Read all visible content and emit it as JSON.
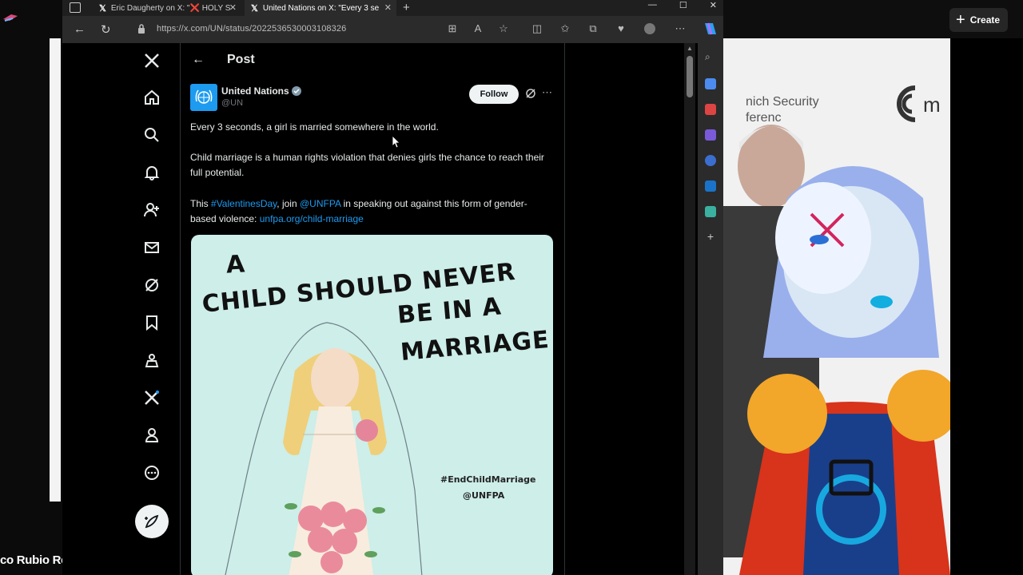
{
  "background": {
    "bottom_name": "co Rubio Re",
    "create_button": "Create",
    "stream_panel_text": "nich Security\nferenc"
  },
  "browser": {
    "tabs": [
      {
        "title": "Eric Daugherty on X: \"❌ HOLY S"
      },
      {
        "title": "United Nations on X: \"Every 3 se"
      }
    ],
    "url": "https://x.com/UN/status/2022536530003108326"
  },
  "x": {
    "post_header": "Post",
    "author": {
      "name": "United Nations",
      "handle": "@UN"
    },
    "follow_label": "Follow",
    "tweet": {
      "line1": "Every 3 seconds, a girl is married somewhere in the world.",
      "line2": "Child marriage is a human rights violation that denies girls the chance to reach their full potential.",
      "line3_prefix": "This ",
      "hashtag": "#ValentinesDay",
      "line3_mid": ", join ",
      "mention": "@UNFPA",
      "line3_suffix": " in speaking out against this form of gender-based violence: ",
      "link": "unfpa.org/child-marriage"
    },
    "image": {
      "word_a": "A",
      "line1": "CHILD SHOULD NEVER",
      "line2": "BE IN A",
      "line3": "MARRIAGE",
      "hashtag": "#EndChildMarriage",
      "handle": "@UNFPA"
    }
  },
  "colors": {
    "accent": "#1d9bf0",
    "poster_bg": "#cdeee9"
  }
}
